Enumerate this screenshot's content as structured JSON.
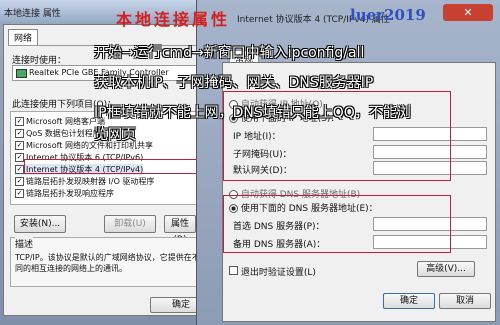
{
  "left_window": {
    "title": "本地连接 属性",
    "tab_network": "网络",
    "connect_using_label": "连接时使用：",
    "adapter_name": "Realtek PCIe GBE Family Controller",
    "uses_items_label": "此连接使用下列项目(O)：",
    "items": [
      "Microsoft 网络客户端",
      "QoS 数据包计划程序",
      "Microsoft 网络的文件和打印机共享",
      "Internet 协议版本 6 (TCP/IPv6)",
      "Internet 协议版本 4 (TCP/IPv4)",
      "链路层拓扑发现映射器 I/O 驱动程序",
      "链路层拓扑发现响应程序"
    ],
    "install_button": "安装(N)...",
    "uninstall_button": "卸载(U)",
    "properties_button": "属性(R)",
    "description_label": "描述",
    "description_text": "TCP/IP。该协议是默认的广域网络协议，它提供在不同的相互连接的网络上的通讯。",
    "ok_button": "确定"
  },
  "right_window": {
    "title": "Internet 协议版本 4 (TCP/IPv4) 属性",
    "tab_general": "常规",
    "auto_ip_radio": "自动获得 IP 地址(O)",
    "manual_ip_radio": "使用下面的 IP 地址(S)：",
    "ip_label": "IP 地址(I)：",
    "subnet_label": "子网掩码(U)：",
    "gateway_label": "默认网关(D)：",
    "auto_dns_radio": "自动获得 DNS 服务器地址(B)",
    "manual_dns_radio": "使用下面的 DNS 服务器地址(E)：",
    "preferred_dns_label": "首选 DNS 服务器(P)：",
    "alternate_dns_label": "备用 DNS 服务器(A)：",
    "validate_checkbox": "退出时验证设置(L)",
    "advanced_button": "高级(V)...",
    "ok_button": "确定",
    "cancel_button": "取消"
  },
  "overlay": {
    "watermark_left": "本地连接属性",
    "watermark_right": "luer2019",
    "line1": "开始→运行cmd→新窗口中输入ipconfig/all",
    "line2": "获取本机IP、子网掩码、网关、DNS服务器IP",
    "line3": "IP框填错就不能上网，DNS填错只能上QQ，不能浏",
    "line4": "览网页"
  }
}
